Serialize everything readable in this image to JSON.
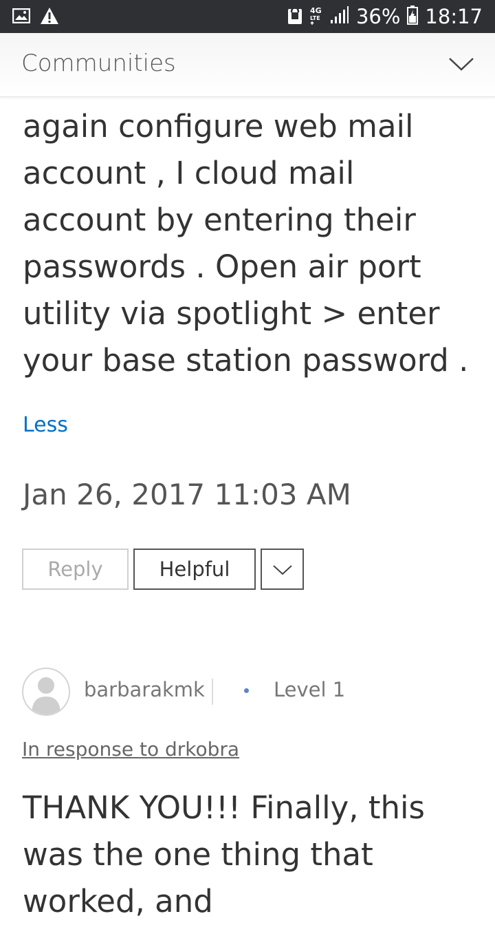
{
  "status_bar": {
    "icons_left": [
      "image-icon",
      "warning-icon"
    ],
    "icons_right": [
      "lock-icon",
      "4g-lte-icon",
      "signal-icon",
      "battery-icon"
    ],
    "battery": "36%",
    "time": "18:17"
  },
  "header": {
    "title": "Communities",
    "toggle_icon": "chevron-down-icon"
  },
  "post": {
    "body": "again configure web mail account , I cloud mail account by entering their passwords . Open air port utility via spotlight > enter your base station password .",
    "less_label": "Less",
    "date": "Jan 26, 2017 11:03 AM",
    "actions": {
      "reply_label": "Reply",
      "helpful_label": "Helpful",
      "more_icon": "chevron-down-icon"
    }
  },
  "reply": {
    "username": "barbarakmk",
    "level": "Level 1",
    "in_response_to": "In response to drkobra",
    "body": "THANK YOU!!! Finally, this was the one thing that worked, and"
  },
  "colors": {
    "status_bar_bg": "#2f3033",
    "link": "#0070c9",
    "text": "#333333",
    "level_dot": "#5a86c8"
  }
}
